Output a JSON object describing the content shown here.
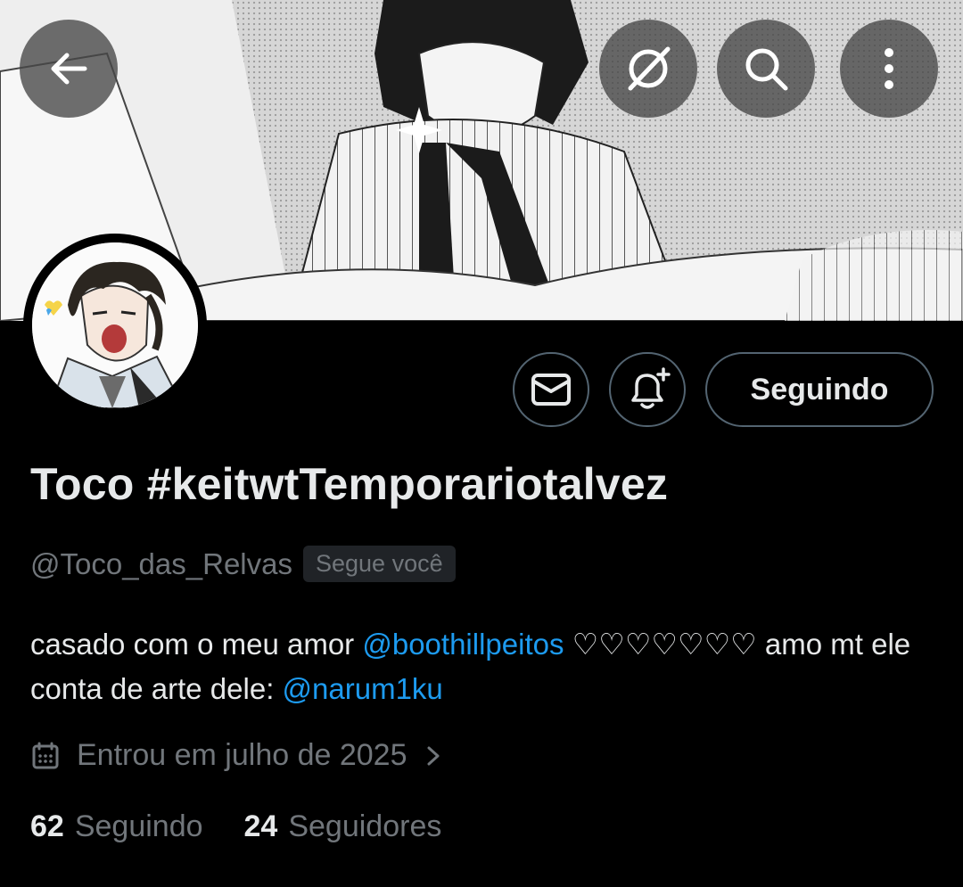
{
  "header": {
    "back_icon": "arrow-left-icon",
    "translate_icon": "grok-slash-icon",
    "search_icon": "search-icon",
    "more_icon": "more-vertical-icon"
  },
  "actions": {
    "message_icon": "envelope-icon",
    "notify_icon": "bell-plus-icon",
    "follow_label": "Seguindo"
  },
  "profile": {
    "display_name": "Toco #keitwtTemporariotalvez",
    "handle": "@Toco_das_Relvas",
    "follows_you": "Segue você",
    "bio": {
      "part1": "casado com o meu amor ",
      "mention1": "@boothillpeitos",
      "hearts": " ♡♡♡♡♡♡♡ ",
      "part2": "amo mt ele conta de arte dele: ",
      "mention2": "@narum1ku"
    },
    "joined": "Entrou em julho de 2025"
  },
  "stats": {
    "following_count": "62",
    "following_label": "Seguindo",
    "followers_count": "24",
    "followers_label": "Seguidores"
  },
  "colors": {
    "background": "#000000",
    "text": "#e7e9ea",
    "muted": "#71767b",
    "link": "#1d9bf0",
    "border": "#536471"
  }
}
